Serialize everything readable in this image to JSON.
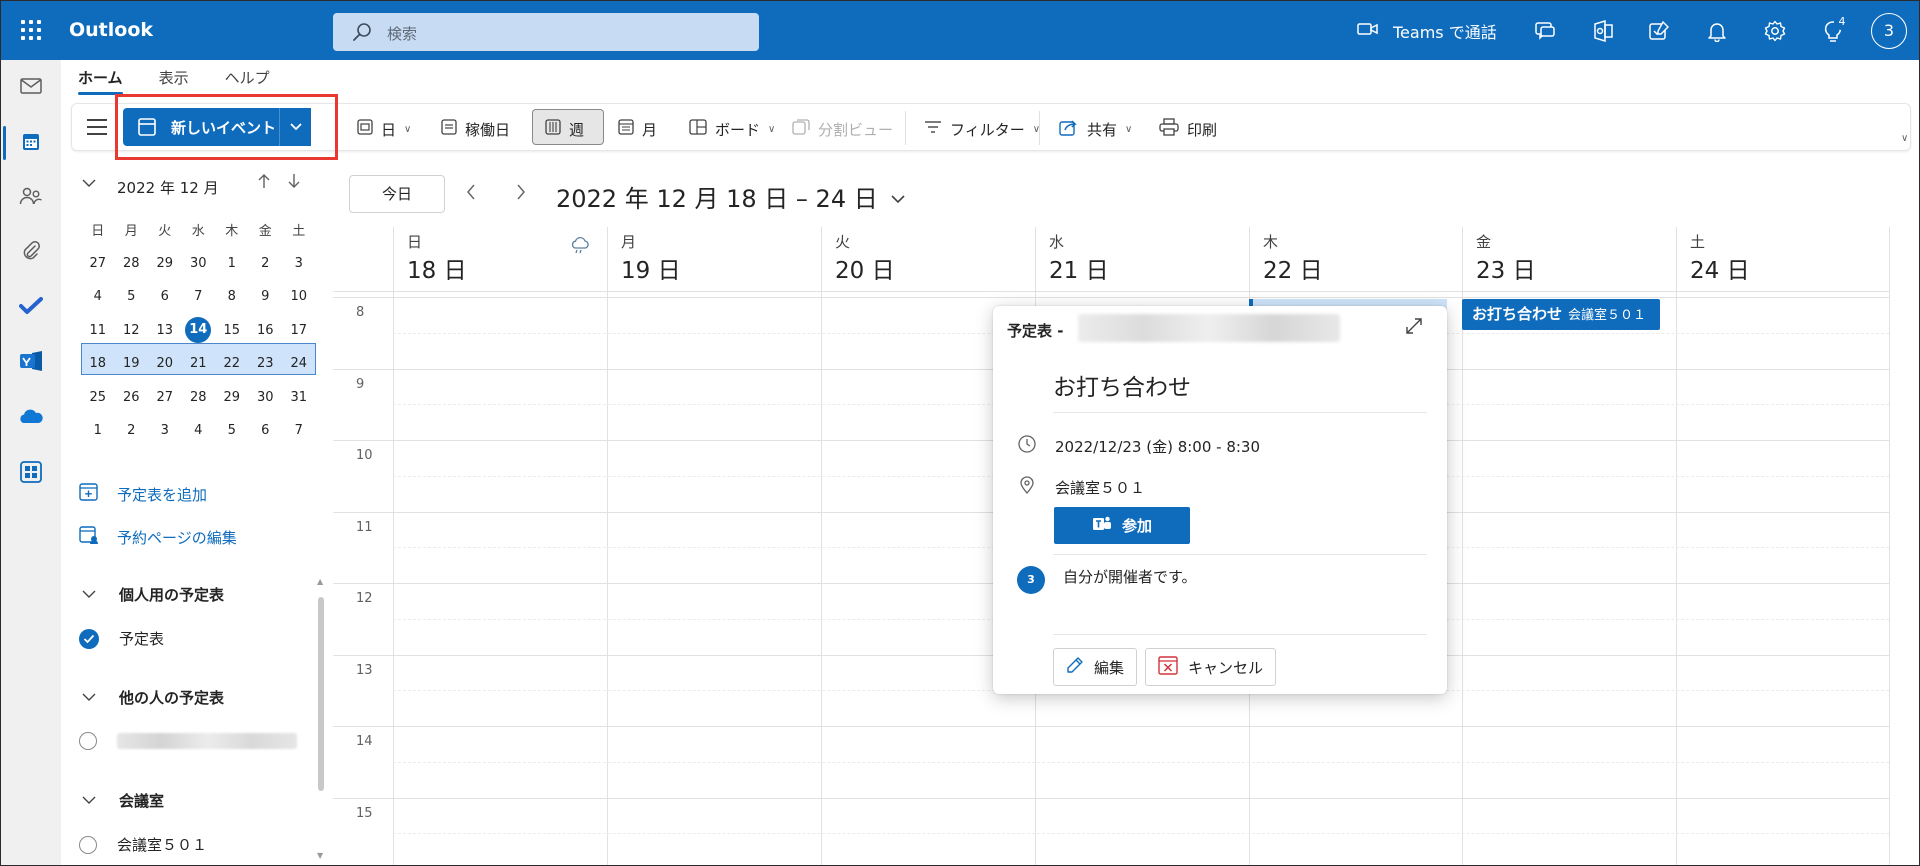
{
  "app": {
    "name": "Outlook",
    "search_placeholder": "検索",
    "teams_call_label": "Teams で通話",
    "tips_badge": "4",
    "user_avatar": "3"
  },
  "ribbon": {
    "tabs": [
      "ホーム",
      "表示",
      "ヘルプ"
    ],
    "new_event_label": "新しいイベント",
    "views": {
      "day": "日",
      "workweek": "稼働日",
      "week": "週",
      "month": "月",
      "board": "ボード",
      "split": "分割ビュー"
    },
    "filter_label": "フィルター",
    "share_label": "共有",
    "print_label": "印刷"
  },
  "mini_calendar": {
    "title": "2022 年 12 月",
    "weekdays": [
      "日",
      "月",
      "火",
      "水",
      "木",
      "金",
      "土"
    ],
    "weeks": [
      [
        "27",
        "28",
        "29",
        "30",
        "1",
        "2",
        "3"
      ],
      [
        "4",
        "5",
        "6",
        "7",
        "8",
        "9",
        "10"
      ],
      [
        "11",
        "12",
        "13",
        "14",
        "15",
        "16",
        "17"
      ],
      [
        "18",
        "19",
        "20",
        "21",
        "22",
        "23",
        "24"
      ],
      [
        "25",
        "26",
        "27",
        "28",
        "29",
        "30",
        "31"
      ],
      [
        "1",
        "2",
        "3",
        "4",
        "5",
        "6",
        "7"
      ]
    ],
    "today": "14"
  },
  "left_pane": {
    "add_calendar": "予定表を追加",
    "edit_booking": "予約ページの編集",
    "personal_section": "個人用の予定表",
    "personal_calendar": "予定表",
    "others_section": "他の人の予定表",
    "rooms_section": "会議室",
    "room_1": "会議室５０１"
  },
  "calendar": {
    "today_button": "今日",
    "range_title": "2022 年 12 月 18 日 – 24 日",
    "days": [
      {
        "dow": "日",
        "date": "18 日"
      },
      {
        "dow": "月",
        "date": "19 日"
      },
      {
        "dow": "火",
        "date": "20 日"
      },
      {
        "dow": "水",
        "date": "21 日"
      },
      {
        "dow": "木",
        "date": "22 日"
      },
      {
        "dow": "金",
        "date": "23 日"
      },
      {
        "dow": "土",
        "date": "24 日"
      }
    ],
    "hours": [
      "8",
      "9",
      "10",
      "11",
      "12",
      "13",
      "14",
      "15"
    ],
    "event": {
      "title": "お打ち合わせ",
      "location": "会議室５０１"
    }
  },
  "popup": {
    "calendar_label": "予定表 -",
    "title": "お打ち合わせ",
    "datetime": "2022/12/23 (金) 8:00 - 8:30",
    "location": "会議室５０１",
    "join_label": "参加",
    "organizer_avatar": "3",
    "organizer_text": "自分が開催者です。",
    "edit_label": "編集",
    "cancel_label": "キャンセル"
  },
  "colors": {
    "brand": "#0f6cbd",
    "highlight": "#e8382f"
  }
}
